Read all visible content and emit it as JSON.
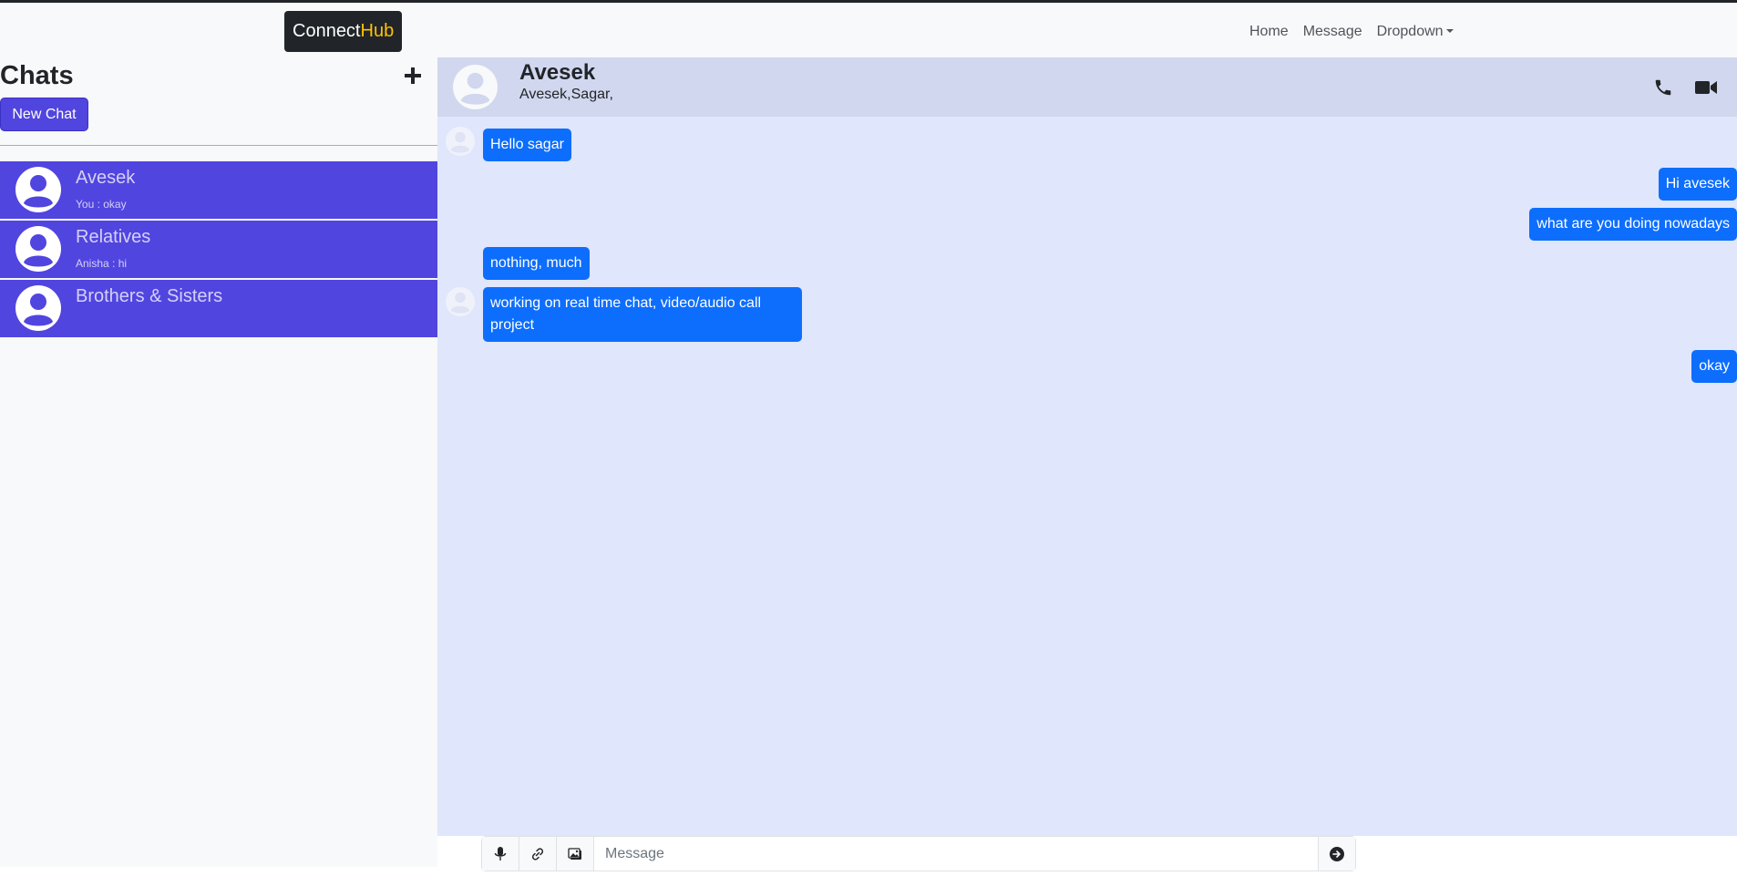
{
  "navbar": {
    "brand_part1": "Connect",
    "brand_part2": "Hub",
    "links": [
      "Home",
      "Message",
      "Dropdown"
    ]
  },
  "sidebar": {
    "title": "Chats",
    "new_chat_label": "New Chat",
    "chats": [
      {
        "name": "Avesek",
        "last_message": "You : okay"
      },
      {
        "name": "Relatives",
        "last_message": "Anisha : hi"
      },
      {
        "name": "Brothers & Sisters",
        "last_message": ""
      }
    ]
  },
  "conversation": {
    "name": "Avesek",
    "members": "Avesek,Sagar,",
    "messages": [
      {
        "text": "Hello sagar",
        "side": "received"
      },
      {
        "text": "Hi avesek",
        "side": "sent"
      },
      {
        "text": "what are you doing nowadays",
        "side": "sent"
      },
      {
        "text": "nothing, much",
        "side": "received"
      },
      {
        "text": "working on real time chat, video/audio call project",
        "side": "received"
      },
      {
        "text": "okay",
        "side": "sent"
      }
    ]
  },
  "composer": {
    "placeholder": "Message"
  },
  "colors": {
    "brand_accent": "#ffc107",
    "chat_item_bg": "#5145e0",
    "message_bubble": "#0d6efd",
    "conversation_bg": "#e0e6fb",
    "header_bg": "#d1d7ee"
  }
}
